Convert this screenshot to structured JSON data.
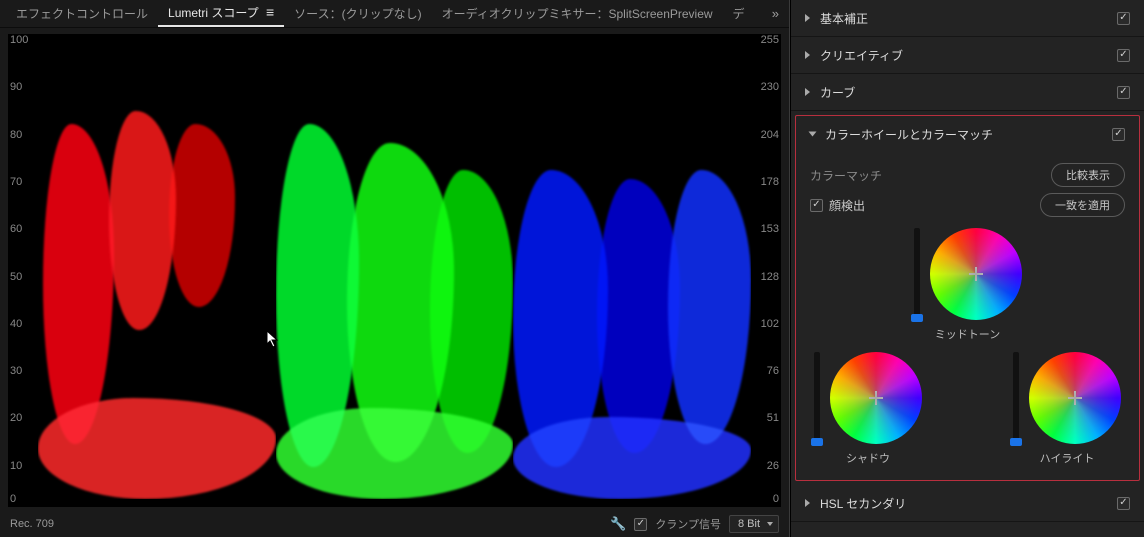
{
  "tabs": {
    "effects": "エフェクトコントロール",
    "lumetri": "Lumetri スコープ",
    "source": "ソース：(クリップなし)",
    "audiomix_prefix": "オーディオクリップミキサー：",
    "audiomix_target": "SplitScreenPreview",
    "cutoff": "デ"
  },
  "scope": {
    "left_ticks": [
      "100",
      "90",
      "80",
      "70",
      "60",
      "50",
      "40",
      "30",
      "20",
      "10",
      "0"
    ],
    "right_ticks": [
      "255",
      "230",
      "204",
      "178",
      "153",
      "128",
      "102",
      "76",
      "51",
      "26",
      "0"
    ]
  },
  "footer": {
    "colorspace": "Rec. 709",
    "clamp_label": "クランプ信号",
    "bitdepth": "8 Bit"
  },
  "panel": {
    "basic": "基本補正",
    "creative": "クリエイティブ",
    "curves": "カーブ",
    "wheels_section": "カラーホイールとカラーマッチ",
    "hsl": "HSL セカンダリ",
    "colormatch_label": "カラーマッチ",
    "compare_btn": "比較表示",
    "facedetect_label": "顔検出",
    "apply_btn": "一致を適用",
    "midtones": "ミッドトーン",
    "shadows": "シャドウ",
    "highlights": "ハイライト"
  }
}
